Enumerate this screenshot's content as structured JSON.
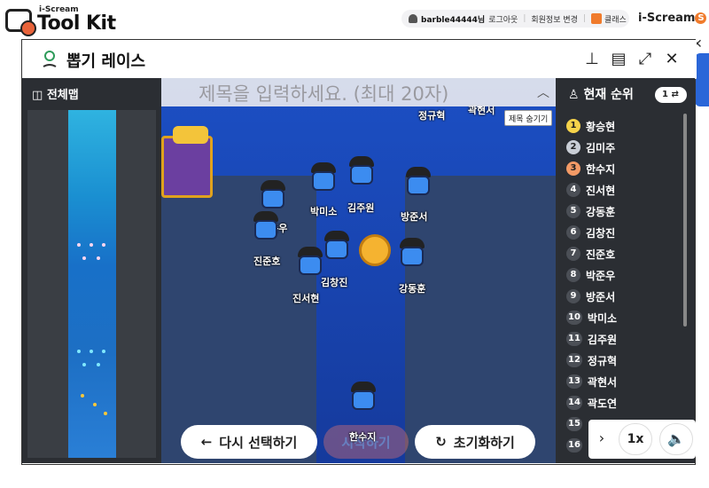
{
  "app": {
    "logo_small": "i-Scream",
    "logo_big": "Tool Kit",
    "user": "barble44444님",
    "logout": "로그아웃",
    "profile_edit": "회원정보 변경",
    "class": "클래스",
    "brand": "i-Scream"
  },
  "window": {
    "title": "뽑기 레이스",
    "icons": [
      "pin-icon",
      "layout-icon",
      "fullscreen-icon",
      "close-icon"
    ]
  },
  "map": {
    "label": "전체맵"
  },
  "game": {
    "title_placeholder": "제목을 입력하세요. (최대 20자)",
    "hide_title": "제목 숨기기",
    "partial_top_labels": [
      "정규혁",
      "곽현서"
    ],
    "players": [
      "박미소",
      "김주원",
      "방준서",
      "박준우",
      "진준호",
      "진서현",
      "김창진",
      "강동훈",
      "한수지"
    ],
    "buttons": {
      "reselect": "다시 선택하기",
      "start": "시작하기",
      "reset": "초기화하기"
    }
  },
  "ranking": {
    "title": "현재 순위",
    "toggle_value": "1",
    "items": [
      {
        "rank": "1",
        "name": "황승현",
        "color": "#f6d34a"
      },
      {
        "rank": "2",
        "name": "김미주",
        "color": "#c9ced6"
      },
      {
        "rank": "3",
        "name": "한수지",
        "color": "#f39a66"
      },
      {
        "rank": "4",
        "name": "진서현",
        "color": "#4b4f56"
      },
      {
        "rank": "5",
        "name": "강동훈",
        "color": "#4b4f56"
      },
      {
        "rank": "6",
        "name": "김창진",
        "color": "#4b4f56"
      },
      {
        "rank": "7",
        "name": "진준호",
        "color": "#4b4f56"
      },
      {
        "rank": "8",
        "name": "박준우",
        "color": "#4b4f56"
      },
      {
        "rank": "9",
        "name": "방준서",
        "color": "#4b4f56"
      },
      {
        "rank": "10",
        "name": "박미소",
        "color": "#4b4f56"
      },
      {
        "rank": "11",
        "name": "김주원",
        "color": "#4b4f56"
      },
      {
        "rank": "12",
        "name": "정규혁",
        "color": "#4b4f56"
      },
      {
        "rank": "13",
        "name": "곽현서",
        "color": "#4b4f56"
      },
      {
        "rank": "14",
        "name": "곽도연",
        "color": "#4b4f56"
      },
      {
        "rank": "15",
        "name": "",
        "color": "#4b4f56"
      },
      {
        "rank": "16",
        "name": "",
        "color": "#4b4f56"
      }
    ]
  },
  "controls": {
    "speed": "1x",
    "next_arrow": "›",
    "sound_icon": "speaker-icon"
  },
  "colors": {
    "accent": "#f07b2c",
    "panel_dark": "#2b2e33",
    "water": "#1c4fc4",
    "side_tab": "#2a66d8"
  }
}
